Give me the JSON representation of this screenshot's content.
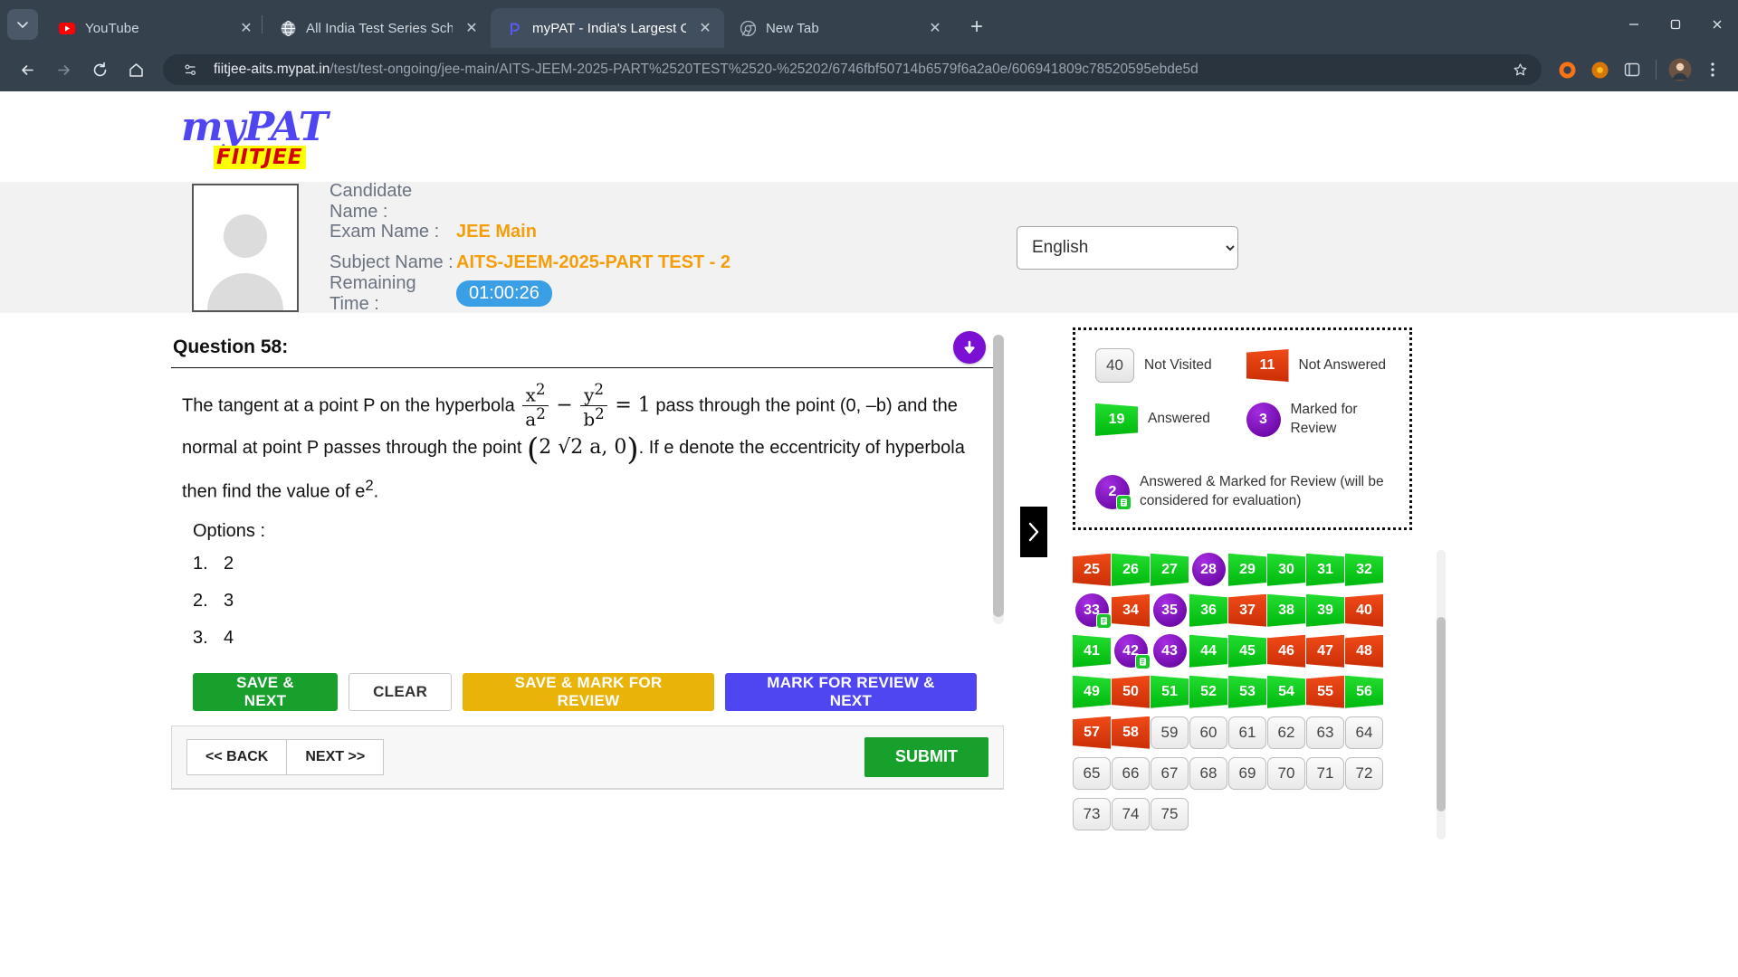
{
  "browser": {
    "tabs": [
      {
        "title": "YouTube",
        "favicon": "youtube-icon",
        "active": false
      },
      {
        "title": "All India Test Series Schdule for",
        "favicon": "globe-icon",
        "active": false
      },
      {
        "title": "myPAT - India's Largest Online ",
        "favicon": "mypat-icon",
        "active": true
      },
      {
        "title": "New Tab",
        "favicon": "chrome-icon",
        "active": false
      }
    ],
    "url_domain": "fiitjee-aits.mypat.in",
    "url_path": "/test/test-ongoing/jee-main/AITS-JEEM-2025-PART%2520TEST%2520-%25202/6746fbf50714b6579f6a2a0e/606941809c78520595ebde5d",
    "new_tab_label": "+",
    "close_label": "✕"
  },
  "header": {
    "logo_main": "myPAT",
    "logo_sub": "FIITJEE",
    "candidate_name_label": "Candidate Name :",
    "candidate_name_value": "",
    "exam_name_label": "Exam Name :",
    "exam_name_value": "JEE Main",
    "subject_name_label": "Subject Name :",
    "subject_name_value": "AITS-JEEM-2025-PART TEST - 2",
    "remaining_time_label": "Remaining Time :",
    "remaining_time_value": "01:00:26",
    "language_selected": "English",
    "language_options": [
      "English"
    ]
  },
  "question": {
    "title": "Question 58:",
    "text_part1": "The tangent at a point P on the hyperbola",
    "frac1_num": "x",
    "frac1_num_exp": "2",
    "frac1_den": "a",
    "frac1_den_exp": "2",
    "minus": "−",
    "frac2_num": "y",
    "frac2_num_exp": "2",
    "frac2_den": "b",
    "frac2_den_exp": "2",
    "equals": "= 1",
    "text_part2": "pass through the point (0, –b) and",
    "text_part3": "the normal at point P passes through the point",
    "point_expr": "2 √2 a, 0",
    "text_part4": ". If e denote the eccentricity of",
    "text_part5": "hyperbola then find the value of e",
    "text_part5_exp": "2",
    "text_part5_end": ".",
    "options_label": "Options :",
    "options": [
      {
        "num": "1.",
        "text": "2"
      },
      {
        "num": "2.",
        "text": "3"
      },
      {
        "num": "3.",
        "text": "4"
      }
    ]
  },
  "actions": {
    "save_next": "SAVE & NEXT",
    "clear": "CLEAR",
    "save_mark_review": "SAVE & MARK FOR REVIEW",
    "mark_review_next": "MARK FOR REVIEW & NEXT",
    "back": "<< BACK",
    "next": "NEXT >>",
    "submit": "SUBMIT"
  },
  "legend": [
    {
      "count": "40",
      "label": "Not Visited",
      "style": "notvisited"
    },
    {
      "count": "11",
      "label": "Not Answered",
      "style": "notanswered"
    },
    {
      "count": "19",
      "label": "Answered",
      "style": "answered"
    },
    {
      "count": "3",
      "label": "Marked for Review",
      "style": "review"
    },
    {
      "count": "2",
      "label": "Answered & Marked for Review (will be considered for evaluation)",
      "style": "review-answered"
    }
  ],
  "palette": [
    {
      "n": "25",
      "s": "red"
    },
    {
      "n": "26",
      "s": "green"
    },
    {
      "n": "27",
      "s": "green"
    },
    {
      "n": "28",
      "s": "purple"
    },
    {
      "n": "29",
      "s": "green"
    },
    {
      "n": "30",
      "s": "green"
    },
    {
      "n": "31",
      "s": "green"
    },
    {
      "n": "32",
      "s": "green"
    },
    {
      "n": "33",
      "s": "purple-answered"
    },
    {
      "n": "34",
      "s": "red"
    },
    {
      "n": "35",
      "s": "purple"
    },
    {
      "n": "36",
      "s": "green"
    },
    {
      "n": "37",
      "s": "red"
    },
    {
      "n": "38",
      "s": "green"
    },
    {
      "n": "39",
      "s": "green"
    },
    {
      "n": "40",
      "s": "red"
    },
    {
      "n": "41",
      "s": "green"
    },
    {
      "n": "42",
      "s": "purple-answered"
    },
    {
      "n": "43",
      "s": "purple"
    },
    {
      "n": "44",
      "s": "green"
    },
    {
      "n": "45",
      "s": "green"
    },
    {
      "n": "46",
      "s": "red"
    },
    {
      "n": "47",
      "s": "red"
    },
    {
      "n": "48",
      "s": "red"
    },
    {
      "n": "49",
      "s": "green"
    },
    {
      "n": "50",
      "s": "red"
    },
    {
      "n": "51",
      "s": "green"
    },
    {
      "n": "52",
      "s": "green"
    },
    {
      "n": "53",
      "s": "green"
    },
    {
      "n": "54",
      "s": "green"
    },
    {
      "n": "55",
      "s": "red"
    },
    {
      "n": "56",
      "s": "green"
    },
    {
      "n": "57",
      "s": "red"
    },
    {
      "n": "58",
      "s": "red"
    },
    {
      "n": "59",
      "s": "gray"
    },
    {
      "n": "60",
      "s": "gray"
    },
    {
      "n": "61",
      "s": "gray"
    },
    {
      "n": "62",
      "s": "gray"
    },
    {
      "n": "63",
      "s": "gray"
    },
    {
      "n": "64",
      "s": "gray"
    },
    {
      "n": "65",
      "s": "gray"
    },
    {
      "n": "66",
      "s": "gray"
    },
    {
      "n": "67",
      "s": "gray"
    },
    {
      "n": "68",
      "s": "gray"
    },
    {
      "n": "69",
      "s": "gray"
    },
    {
      "n": "70",
      "s": "gray"
    },
    {
      "n": "71",
      "s": "gray"
    },
    {
      "n": "72",
      "s": "gray"
    },
    {
      "n": "73",
      "s": "gray"
    },
    {
      "n": "74",
      "s": "gray"
    },
    {
      "n": "75",
      "s": "gray"
    }
  ],
  "colors": {
    "accent": "#4f46f2",
    "answered": "#00b80e",
    "not_answered": "#cc2f06",
    "review": "#6d0aa8",
    "timer": "#3b9fe6",
    "value_text": "#f59e0b"
  }
}
